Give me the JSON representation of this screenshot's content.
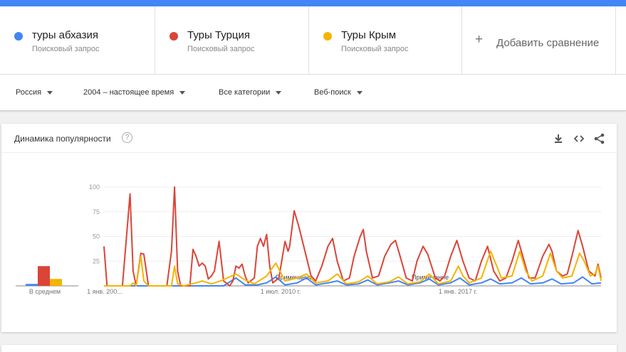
{
  "terms": [
    {
      "name": "туры абхазия",
      "sub": "Поисковый запрос",
      "color": "#4285f4"
    },
    {
      "name": "Туры Турция",
      "sub": "Поисковый запрос",
      "color": "#db4437"
    },
    {
      "name": "Туры Крым",
      "sub": "Поисковый запрос",
      "color": "#f4b400"
    }
  ],
  "add_compare": "Добавить сравнение",
  "filters": {
    "region": "Россия",
    "period": "2004 – настоящее время",
    "category": "Все категории",
    "search_type": "Веб-поиск"
  },
  "card": {
    "title": "Динамика популярности",
    "help": "?"
  },
  "icons": [
    "help-icon",
    "download-icon",
    "embed-icon",
    "share-icon",
    "plus-icon",
    "caret-down-icon"
  ],
  "chart_data": {
    "type": "line",
    "ylim": [
      0,
      100
    ],
    "yticks": [
      "100",
      "75",
      "50",
      "25"
    ],
    "xticks": [
      "1 янв. 200...",
      "1 июл. 2010 г.",
      "1 янв. 2017 г."
    ],
    "notes": [
      "Примечание",
      "Примечание"
    ],
    "average_label": "В среднем",
    "averages": [
      2,
      20,
      7
    ],
    "xrange": [
      2004.0,
      2020.2
    ],
    "series": [
      {
        "name": "туры абхазия",
        "color": "#4285f4",
        "points": [
          [
            2004.0,
            0
          ],
          [
            2007.9,
            0
          ],
          [
            2008.3,
            8
          ],
          [
            2008.6,
            1
          ],
          [
            2009.0,
            1
          ],
          [
            2009.3,
            3
          ],
          [
            2009.6,
            9
          ],
          [
            2009.9,
            1
          ],
          [
            2010.3,
            3
          ],
          [
            2010.6,
            8
          ],
          [
            2010.9,
            1
          ],
          [
            2011.3,
            3
          ],
          [
            2011.6,
            5
          ],
          [
            2011.9,
            1
          ],
          [
            2012.3,
            2
          ],
          [
            2012.6,
            6
          ],
          [
            2012.9,
            1
          ],
          [
            2013.3,
            3
          ],
          [
            2013.6,
            5
          ],
          [
            2013.9,
            1
          ],
          [
            2014.3,
            3
          ],
          [
            2014.6,
            7
          ],
          [
            2014.9,
            1
          ],
          [
            2015.3,
            3
          ],
          [
            2015.6,
            8
          ],
          [
            2015.9,
            1
          ],
          [
            2016.3,
            3
          ],
          [
            2016.6,
            7
          ],
          [
            2016.9,
            2
          ],
          [
            2017.3,
            3
          ],
          [
            2017.6,
            8
          ],
          [
            2017.9,
            2
          ],
          [
            2018.3,
            3
          ],
          [
            2018.6,
            7
          ],
          [
            2018.9,
            2
          ],
          [
            2019.3,
            3
          ],
          [
            2019.6,
            9
          ],
          [
            2019.9,
            2
          ],
          [
            2020.2,
            3
          ]
        ]
      },
      {
        "name": "Туры Турция",
        "color": "#db4437",
        "points": [
          [
            2004.0,
            40
          ],
          [
            2004.1,
            0
          ],
          [
            2004.6,
            0
          ],
          [
            2004.85,
            93
          ],
          [
            2004.95,
            15
          ],
          [
            2005.05,
            0
          ],
          [
            2005.2,
            33
          ],
          [
            2005.3,
            32
          ],
          [
            2005.45,
            0
          ],
          [
            2006.05,
            0
          ],
          [
            2006.2,
            35
          ],
          [
            2006.3,
            100
          ],
          [
            2006.4,
            15
          ],
          [
            2006.5,
            0
          ],
          [
            2006.8,
            0
          ],
          [
            2006.9,
            37
          ],
          [
            2007.0,
            30
          ],
          [
            2007.1,
            20
          ],
          [
            2007.2,
            23
          ],
          [
            2007.3,
            20
          ],
          [
            2007.4,
            7
          ],
          [
            2007.5,
            10
          ],
          [
            2007.6,
            15
          ],
          [
            2007.75,
            45
          ],
          [
            2007.9,
            5
          ],
          [
            2008.1,
            0
          ],
          [
            2008.2,
            5
          ],
          [
            2008.3,
            20
          ],
          [
            2008.4,
            18
          ],
          [
            2008.5,
            22
          ],
          [
            2008.6,
            10
          ],
          [
            2008.7,
            3
          ],
          [
            2008.9,
            8
          ],
          [
            2009.0,
            40
          ],
          [
            2009.1,
            48
          ],
          [
            2009.2,
            40
          ],
          [
            2009.3,
            52
          ],
          [
            2009.4,
            20
          ],
          [
            2009.5,
            3
          ],
          [
            2009.7,
            8
          ],
          [
            2009.9,
            45
          ],
          [
            2010.0,
            35
          ],
          [
            2010.05,
            40
          ],
          [
            2010.2,
            76
          ],
          [
            2010.35,
            60
          ],
          [
            2010.55,
            35
          ],
          [
            2010.75,
            10
          ],
          [
            2010.9,
            5
          ],
          [
            2011.1,
            20
          ],
          [
            2011.3,
            40
          ],
          [
            2011.45,
            48
          ],
          [
            2011.6,
            25
          ],
          [
            2011.8,
            5
          ],
          [
            2012.0,
            8
          ],
          [
            2012.15,
            30
          ],
          [
            2012.35,
            50
          ],
          [
            2012.45,
            57
          ],
          [
            2012.55,
            35
          ],
          [
            2012.75,
            8
          ],
          [
            2012.95,
            10
          ],
          [
            2013.15,
            30
          ],
          [
            2013.35,
            42
          ],
          [
            2013.5,
            46
          ],
          [
            2013.65,
            30
          ],
          [
            2013.85,
            8
          ],
          [
            2014.05,
            5
          ],
          [
            2014.2,
            25
          ],
          [
            2014.4,
            40
          ],
          [
            2014.55,
            32
          ],
          [
            2014.8,
            8
          ],
          [
            2014.95,
            5
          ],
          [
            2015.1,
            10
          ],
          [
            2015.3,
            30
          ],
          [
            2015.5,
            46
          ],
          [
            2015.7,
            25
          ],
          [
            2015.9,
            8
          ],
          [
            2016.1,
            5
          ],
          [
            2016.3,
            25
          ],
          [
            2016.5,
            40
          ],
          [
            2016.7,
            15
          ],
          [
            2016.9,
            5
          ],
          [
            2017.1,
            8
          ],
          [
            2017.3,
            25
          ],
          [
            2017.5,
            46
          ],
          [
            2017.65,
            30
          ],
          [
            2017.85,
            8
          ],
          [
            2018.05,
            8
          ],
          [
            2018.3,
            30
          ],
          [
            2018.5,
            42
          ],
          [
            2018.6,
            35
          ],
          [
            2018.75,
            15
          ],
          [
            2018.95,
            10
          ],
          [
            2019.1,
            12
          ],
          [
            2019.25,
            30
          ],
          [
            2019.45,
            56
          ],
          [
            2019.6,
            40
          ],
          [
            2019.8,
            15
          ],
          [
            2020.0,
            10
          ],
          [
            2020.1,
            22
          ],
          [
            2020.2,
            8
          ]
        ]
      },
      {
        "name": "Туры Крым",
        "color": "#f4b400",
        "points": [
          [
            2004.0,
            0
          ],
          [
            2004.85,
            0
          ],
          [
            2004.95,
            3
          ],
          [
            2005.05,
            0
          ],
          [
            2005.2,
            30
          ],
          [
            2005.3,
            5
          ],
          [
            2005.45,
            0
          ],
          [
            2006.2,
            0
          ],
          [
            2006.3,
            20
          ],
          [
            2006.4,
            2
          ],
          [
            2006.6,
            0
          ],
          [
            2007.0,
            3
          ],
          [
            2007.2,
            5
          ],
          [
            2007.5,
            2
          ],
          [
            2007.8,
            5
          ],
          [
            2008.3,
            12
          ],
          [
            2008.6,
            6
          ],
          [
            2008.9,
            2
          ],
          [
            2009.3,
            10
          ],
          [
            2009.6,
            23
          ],
          [
            2009.9,
            5
          ],
          [
            2010.3,
            8
          ],
          [
            2010.6,
            12
          ],
          [
            2010.9,
            3
          ],
          [
            2011.3,
            5
          ],
          [
            2011.6,
            12
          ],
          [
            2011.9,
            2
          ],
          [
            2012.3,
            4
          ],
          [
            2012.6,
            10
          ],
          [
            2012.9,
            2
          ],
          [
            2013.3,
            4
          ],
          [
            2013.6,
            9
          ],
          [
            2013.9,
            2
          ],
          [
            2014.3,
            4
          ],
          [
            2014.6,
            12
          ],
          [
            2014.9,
            2
          ],
          [
            2015.3,
            5
          ],
          [
            2015.55,
            20
          ],
          [
            2015.7,
            10
          ],
          [
            2015.9,
            3
          ],
          [
            2016.3,
            8
          ],
          [
            2016.6,
            35
          ],
          [
            2016.8,
            20
          ],
          [
            2016.95,
            8
          ],
          [
            2017.3,
            10
          ],
          [
            2017.55,
            35
          ],
          [
            2017.75,
            15
          ],
          [
            2017.95,
            5
          ],
          [
            2018.3,
            10
          ],
          [
            2018.55,
            33
          ],
          [
            2018.75,
            15
          ],
          [
            2018.95,
            8
          ],
          [
            2019.25,
            10
          ],
          [
            2019.5,
            33
          ],
          [
            2019.65,
            25
          ],
          [
            2019.85,
            10
          ],
          [
            2020.0,
            12
          ],
          [
            2020.1,
            20
          ],
          [
            2020.2,
            5
          ]
        ]
      }
    ]
  }
}
